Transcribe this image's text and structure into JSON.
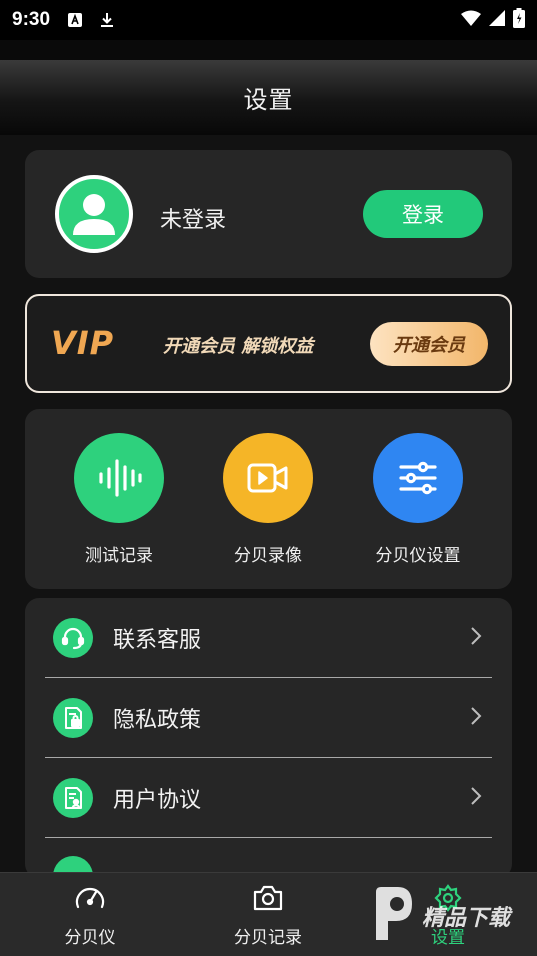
{
  "status_bar": {
    "time": "9:30",
    "icons": [
      "text-a-icon",
      "download-icon",
      "wifi-icon",
      "signal-icon",
      "battery-icon"
    ]
  },
  "header": {
    "title": "设置"
  },
  "profile": {
    "name": "未登录",
    "login_label": "登录",
    "avatar_icon": "user-avatar-icon"
  },
  "vip": {
    "logo": "VIP",
    "slogan": "开通会员  解锁权益",
    "button_label": "开通会员"
  },
  "features": [
    {
      "label": "测试记录",
      "icon": "sound-wave-icon",
      "color": "#2ed17d"
    },
    {
      "label": "分贝录像",
      "icon": "video-icon",
      "color": "#f5b527"
    },
    {
      "label": "分贝仪设置",
      "icon": "sliders-icon",
      "color": "#2f86f2"
    }
  ],
  "menu": [
    {
      "label": "联系客服",
      "icon": "headset-icon"
    },
    {
      "label": "隐私政策",
      "icon": "privacy-doc-icon"
    },
    {
      "label": "用户协议",
      "icon": "agreement-doc-icon"
    }
  ],
  "bottom_nav": [
    {
      "label": "分贝仪",
      "icon": "gauge-icon"
    },
    {
      "label": "分贝记录",
      "icon": "camera-icon"
    },
    {
      "label": "设置",
      "icon": "gear-icon",
      "active": true
    }
  ],
  "watermark": {
    "text": "精品下载"
  },
  "colors": {
    "accent": "#2ed17d",
    "background": "#121212",
    "card": "#262626"
  }
}
